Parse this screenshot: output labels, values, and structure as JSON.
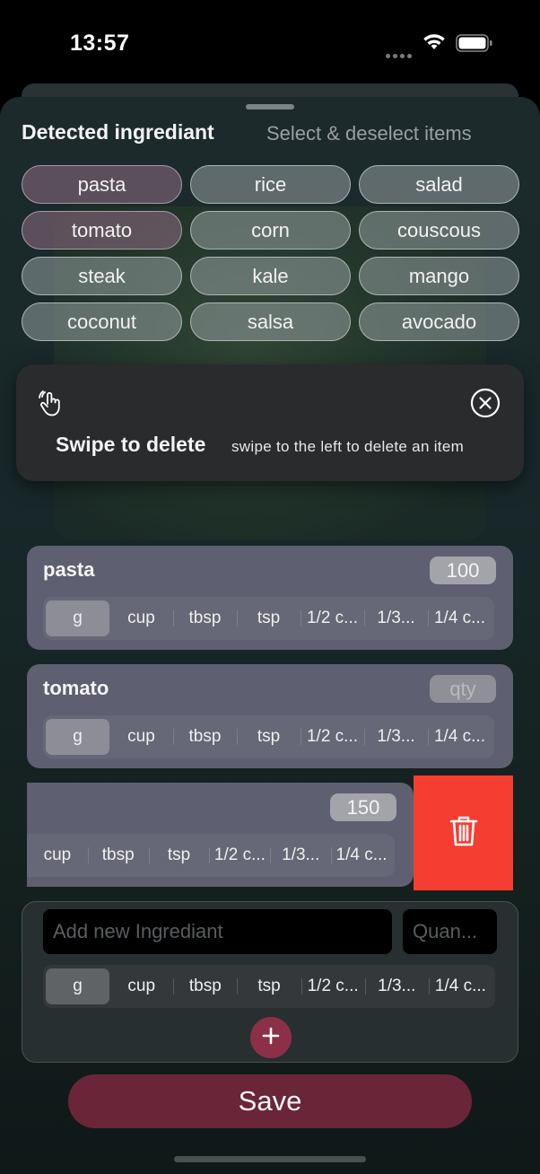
{
  "status_bar": {
    "time": "13:57"
  },
  "header": {
    "title": "Detected ingrediant",
    "subtitle": "Select & deselect items"
  },
  "chips": [
    {
      "label": "pasta",
      "selected": true
    },
    {
      "label": "rice",
      "selected": false
    },
    {
      "label": "salad",
      "selected": false
    },
    {
      "label": "tomato",
      "selected": true
    },
    {
      "label": "corn",
      "selected": false
    },
    {
      "label": "couscous",
      "selected": false
    },
    {
      "label": "steak",
      "selected": false
    },
    {
      "label": "kale",
      "selected": false
    },
    {
      "label": "mango",
      "selected": false
    },
    {
      "label": "coconut",
      "selected": false
    },
    {
      "label": "salsa",
      "selected": false
    },
    {
      "label": "avocado",
      "selected": false
    }
  ],
  "tip": {
    "title": "Swipe to delete",
    "text": "swipe to the left to delete an item"
  },
  "units": [
    "g",
    "cup",
    "tbsp",
    "tsp",
    "1/2 c...",
    "1/3...",
    "1/4 c..."
  ],
  "units_swiped": [
    "cup",
    "tbsp",
    "tsp",
    "1/2 c...",
    "1/3...",
    "1/4 c..."
  ],
  "ingredients": [
    {
      "name": "pasta",
      "qty": "100",
      "unit": "g"
    },
    {
      "name": "tomato",
      "qty_placeholder": "qty",
      "unit": "g"
    },
    {
      "name": "",
      "qty": "150"
    }
  ],
  "add_new": {
    "name_placeholder": "Add new Ingrediant",
    "qty_placeholder": "Quan...",
    "unit": "g"
  },
  "save_label": "Save",
  "colors": {
    "delete": "#f53d32",
    "accent": "#6b2538",
    "plus": "#8c3047"
  },
  "icons": [
    "wifi-icon",
    "battery-icon",
    "hand-tap-icon",
    "close-circle-icon",
    "trash-icon",
    "plus-icon"
  ]
}
